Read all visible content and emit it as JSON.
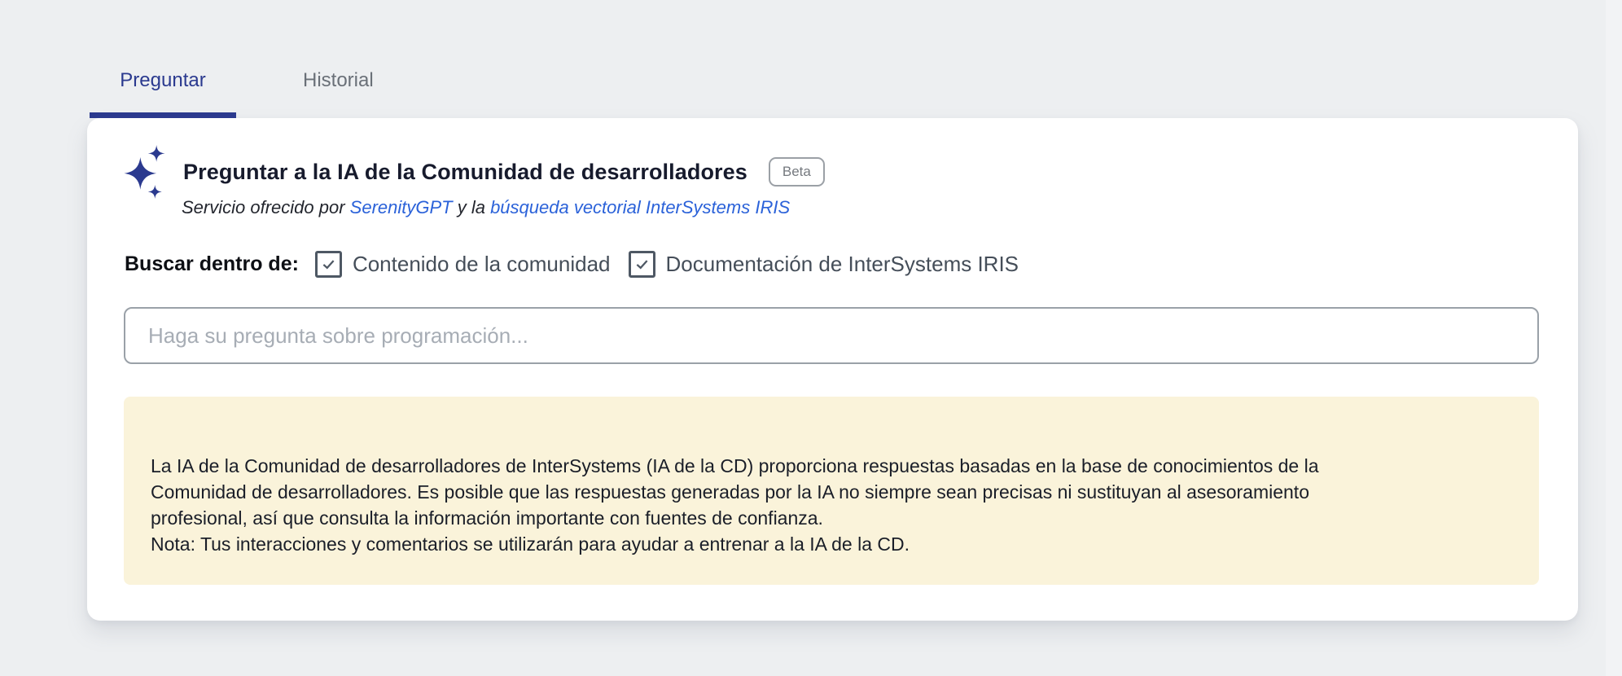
{
  "tabs": [
    {
      "label": "Preguntar",
      "active": true
    },
    {
      "label": "Historial",
      "active": false
    }
  ],
  "card": {
    "title": "Preguntar a la IA de la Comunidad de desarrolladores",
    "badge": "Beta",
    "subtitle": {
      "prefix": "Servicio ofrecido por ",
      "link1": "SerenityGPT",
      "middle": " y la ",
      "link2": "búsqueda vectorial InterSystems IRIS"
    },
    "search_scope": {
      "label": "Buscar dentro de:",
      "options": [
        {
          "label": "Contenido de la comunidad",
          "checked": true
        },
        {
          "label": "Documentación de InterSystems IRIS",
          "checked": true
        }
      ]
    },
    "input": {
      "value": "",
      "placeholder": "Haga su pregunta sobre programación..."
    },
    "disclaimer": {
      "text": "La IA de la Comunidad de desarrolladores de InterSystems (IA de la CD) proporciona respuestas basadas en la base de conocimientos de la\nComunidad de desarrolladores. Es posible que las respuestas generadas por la IA no siempre sean precisas ni sustituyan al asesoramiento\nprofesional, así que consulta la información importante con fuentes de confianza.\nNota: Tus interacciones y comentarios se utilizarán para ayudar a entrenar a la IA de la CD."
    }
  },
  "colors": {
    "accent": "#2b3a8f",
    "link": "#2b62d9",
    "page_bg": "#edeff1",
    "disclaimer_bg": "#faf3da"
  }
}
